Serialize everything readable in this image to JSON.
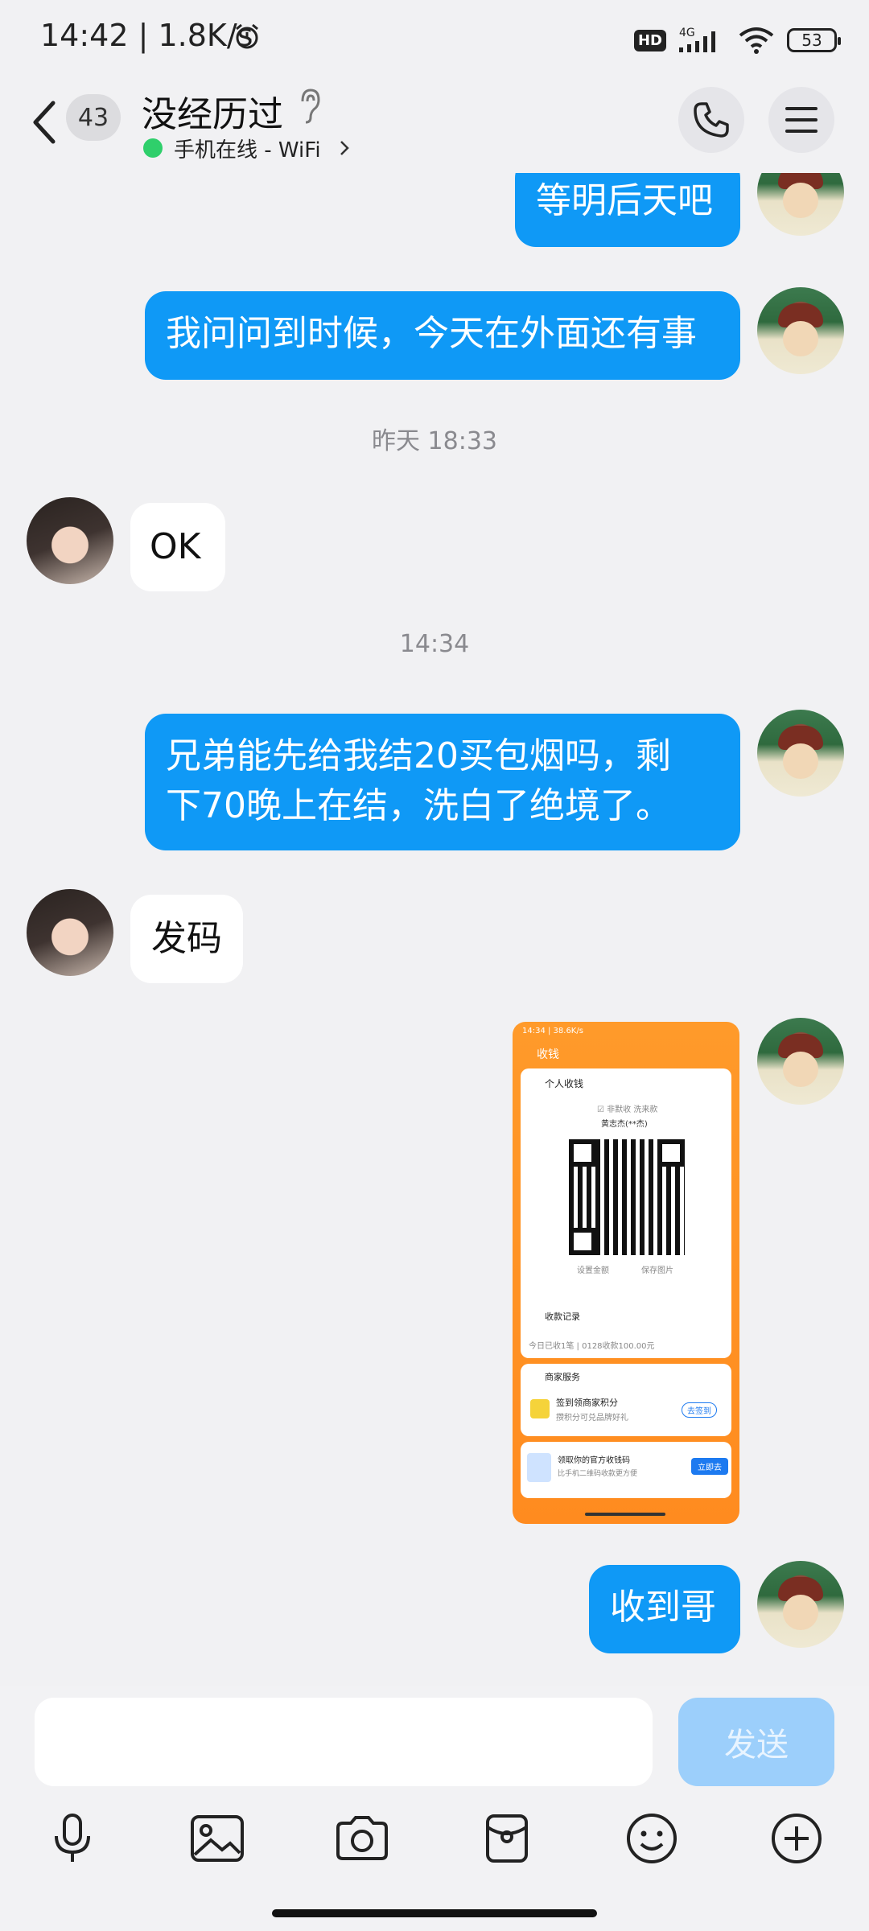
{
  "status_bar": {
    "time": "14:42 | 1.8K/s",
    "hd": "HD",
    "network": "4G",
    "battery": "53"
  },
  "header": {
    "back_badge": "43",
    "title": "没经历过",
    "subtitle": "手机在线 - WiFi"
  },
  "messages": [
    {
      "side": "out",
      "text": "等明后天吧"
    },
    {
      "side": "out",
      "text": "我问问到时候，今天在外面还有事"
    },
    {
      "timestamp": "昨天 18:33"
    },
    {
      "side": "in",
      "text": "OK"
    },
    {
      "timestamp": "14:34"
    },
    {
      "side": "out",
      "text": "兄弟能先给我结20买包烟吗，剩下70晚上在结，洗白了绝境了。"
    },
    {
      "side": "in",
      "text": "发码"
    },
    {
      "side": "out",
      "type": "image"
    },
    {
      "side": "out",
      "text": "收到哥"
    }
  ],
  "chat": {
    "ts1": "昨天 18:33",
    "ts2": "14:34",
    "m1": "等明后天吧",
    "m2": "我问问到时候，今天在外面还有事",
    "m3": "OK",
    "m4_line1": "兄弟能先给我结20买包烟吗，剩",
    "m4_line2": "下70晚上在结，洗白了绝境了。",
    "m5": "发码",
    "m6": "收到哥"
  },
  "screenshot_thumb": {
    "status": "14:34 | 38.6K/s",
    "title": "收钱",
    "card_title": "个人收钱",
    "tips": "☑ 非默收 洗来款",
    "payee": "黄志杰(**杰)",
    "set_amount": "设置金额",
    "save_image": "保存图片",
    "records": "收款记录",
    "today": "今日已收1笔 | 0128收款100.00元",
    "merchant": "商家服务",
    "points_title": "签到领商家积分",
    "points_sub": "攒积分可兑品牌好礼",
    "sign_btn": "去签到",
    "official_title": "领取你的官方收钱码",
    "official_sub": "比手机二维码收款更方便",
    "claim_btn": "立即去"
  },
  "input": {
    "placeholder": "",
    "send_label": "发送"
  },
  "toolbar_icons": [
    "microphone-icon",
    "image-icon",
    "camera-icon",
    "red-packet-icon",
    "emoji-icon",
    "plus-icon"
  ],
  "colors": {
    "outgoing_bubble": "#0f99f6",
    "incoming_bubble": "#ffffff",
    "send_button_disabled": "#9ccffb",
    "online_dot": "#2fcf6b"
  }
}
